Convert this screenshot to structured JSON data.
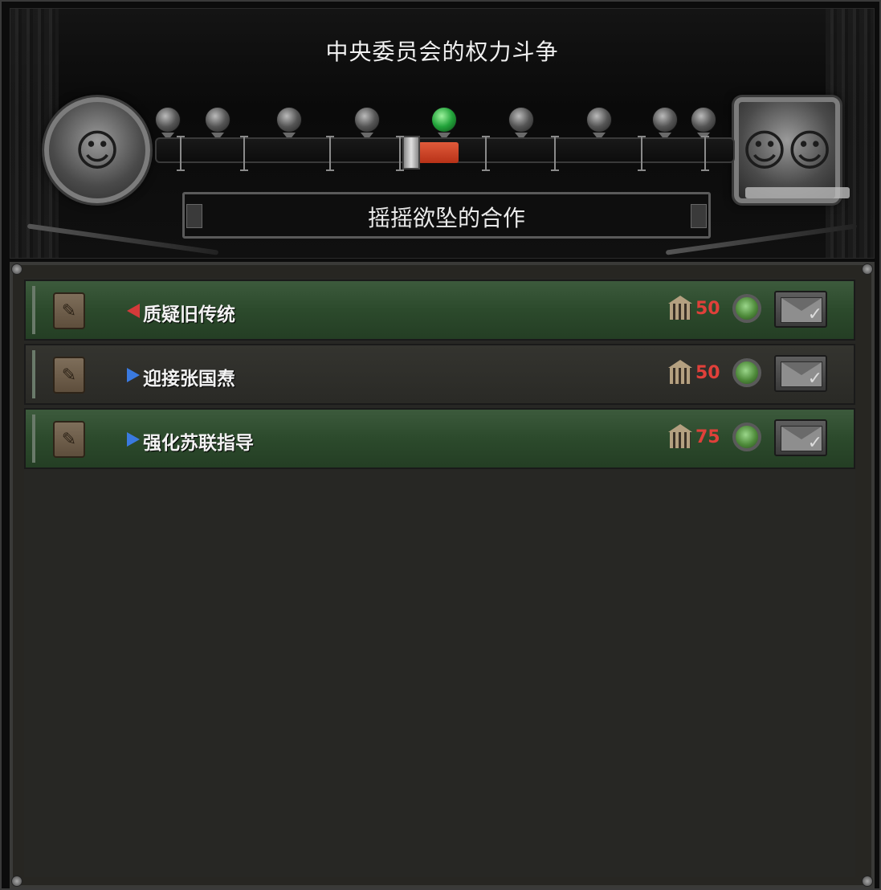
{
  "header": {
    "title": "中央委员会的权力斗争",
    "status": "摇摇欲坠的合作",
    "balance_position": 0.44,
    "active_marker_index": 4,
    "marker_count": 9
  },
  "decisions": [
    {
      "label": "质疑旧传统",
      "direction": "left",
      "cost": "50",
      "style": "green"
    },
    {
      "label": "迎接张国焘",
      "direction": "right",
      "cost": "50",
      "style": "dark"
    },
    {
      "label": "强化苏联指导",
      "direction": "right",
      "cost": "75",
      "style": "green"
    }
  ],
  "colors": {
    "accent_red": "#e0403a",
    "active_green": "#22a33a",
    "arrow_red": "#d43a3a",
    "arrow_blue": "#3a7ae0"
  },
  "icons": {
    "left_portrait": "leader-portrait-icon",
    "right_portrait": "rival-portrait-icon",
    "clipboard": "clipboard-icon",
    "cost": "political-power-icon",
    "send": "envelope-check-icon"
  }
}
